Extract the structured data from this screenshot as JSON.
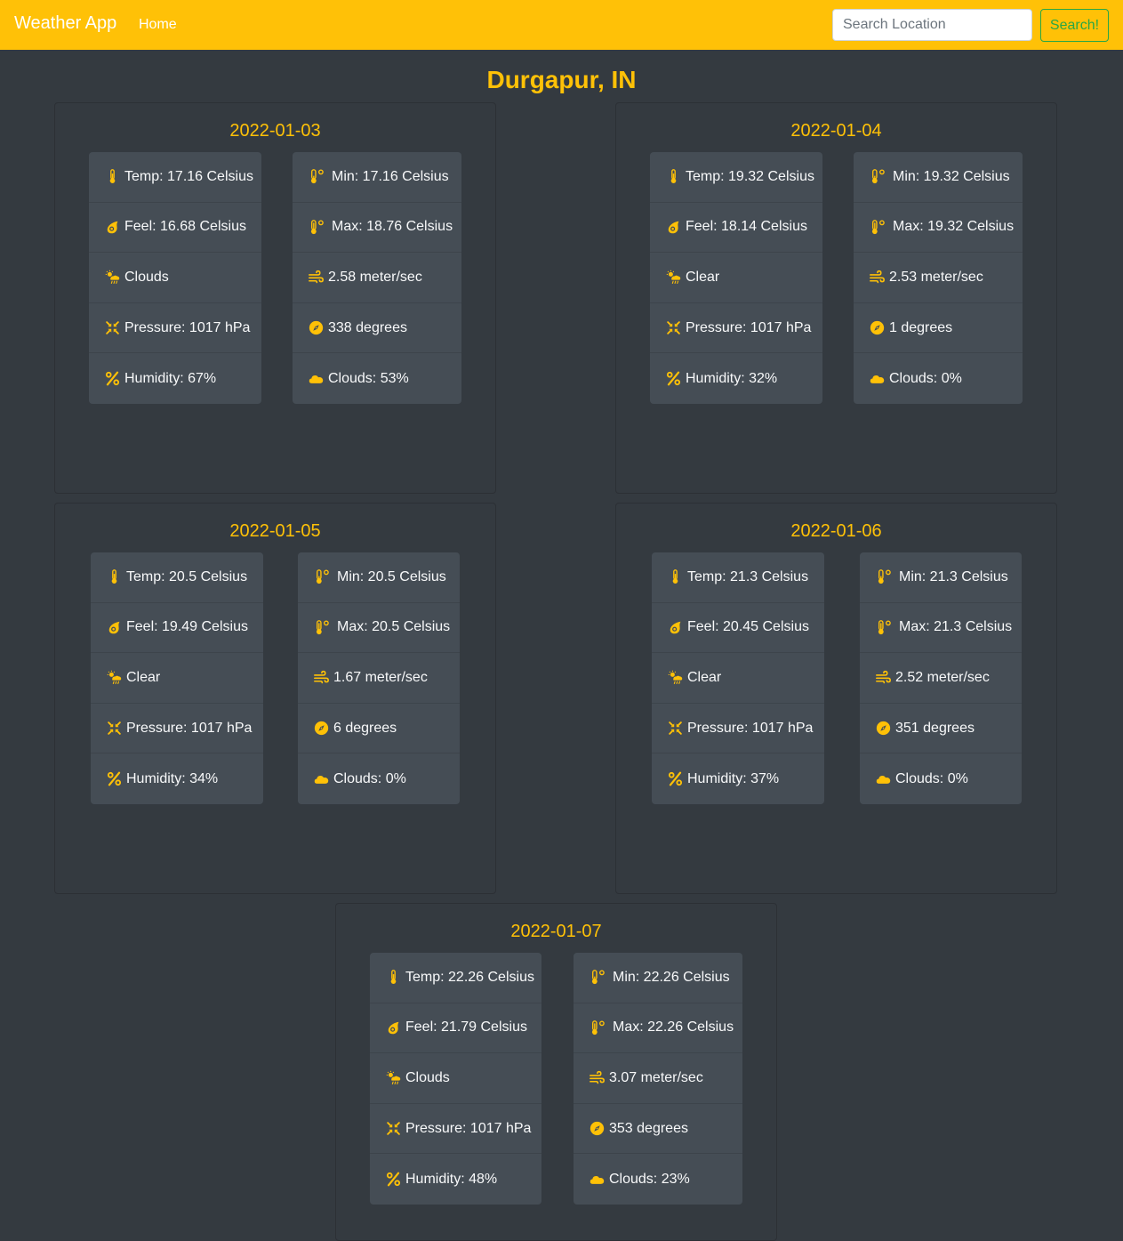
{
  "navbar": {
    "brand": "Weather App",
    "home": "Home",
    "search_placeholder": "Search Location",
    "search_value": "",
    "search_button": "Search!"
  },
  "colors": {
    "navbar_bg": "#ffc107",
    "accent": "#ffc107",
    "page_bg": "#343a40",
    "card_bg": "#454d55",
    "search_button": "#28a745"
  },
  "location": "Durgapur, IN",
  "icons": {
    "temp": "thermometer-icon",
    "feel": "fire-icon",
    "weather": "cloud-sun-rain-icon",
    "pressure": "compress-icon",
    "humidity": "percent-icon",
    "min": "temperature-low-icon",
    "max": "temperature-high-icon",
    "wind": "wind-icon",
    "direction": "compass-icon",
    "clouds": "cloud-icon"
  },
  "days": [
    {
      "date": "2022-01-03",
      "left": [
        "Temp: 17.16 Celsius",
        "Feel: 16.68 Celsius",
        "Clouds",
        "Pressure: 1017 hPa",
        "Humidity: 67%"
      ],
      "right": [
        "Min: 17.16 Celsius",
        "Max: 18.76 Celsius",
        "2.58 meter/sec",
        "338 degrees",
        "Clouds: 53%"
      ]
    },
    {
      "date": "2022-01-04",
      "left": [
        "Temp: 19.32 Celsius",
        "Feel: 18.14 Celsius",
        "Clear",
        "Pressure: 1017 hPa",
        "Humidity: 32%"
      ],
      "right": [
        "Min: 19.32 Celsius",
        "Max: 19.32 Celsius",
        "2.53 meter/sec",
        "1 degrees",
        "Clouds: 0%"
      ]
    },
    {
      "date": "2022-01-05",
      "left": [
        "Temp: 20.5 Celsius",
        "Feel: 19.49 Celsius",
        "Clear",
        "Pressure: 1017 hPa",
        "Humidity: 34%"
      ],
      "right": [
        "Min: 20.5 Celsius",
        "Max: 20.5 Celsius",
        "1.67 meter/sec",
        "6 degrees",
        "Clouds: 0%"
      ]
    },
    {
      "date": "2022-01-06",
      "left": [
        "Temp: 21.3 Celsius",
        "Feel: 20.45 Celsius",
        "Clear",
        "Pressure: 1017 hPa",
        "Humidity: 37%"
      ],
      "right": [
        "Min: 21.3 Celsius",
        "Max: 21.3 Celsius",
        "2.52 meter/sec",
        "351 degrees",
        "Clouds: 0%"
      ]
    },
    {
      "date": "2022-01-07",
      "left": [
        "Temp: 22.26 Celsius",
        "Feel: 21.79 Celsius",
        "Clouds",
        "Pressure: 1017 hPa",
        "Humidity: 48%"
      ],
      "right": [
        "Min: 22.26 Celsius",
        "Max: 22.26 Celsius",
        "3.07 meter/sec",
        "353 degrees",
        "Clouds: 23%"
      ]
    }
  ]
}
